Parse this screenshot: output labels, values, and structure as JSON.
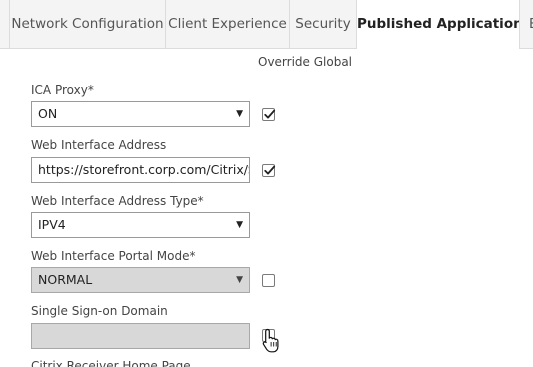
{
  "tabs": [
    {
      "label": "Network Configuration",
      "active": false
    },
    {
      "label": "Client Experience",
      "active": false
    },
    {
      "label": "Security",
      "active": false
    },
    {
      "label": "Published Applications",
      "active": true
    },
    {
      "label": "E",
      "active": false
    }
  ],
  "override_header": "Override Global",
  "fields": {
    "ica_proxy": {
      "label": "ICA Proxy*",
      "value": "ON",
      "override_checked": true
    },
    "web_interface_address": {
      "label": "Web Interface Address",
      "value": "https://storefront.corp.com/Citrix/St",
      "override_checked": true
    },
    "web_interface_address_type": {
      "label": "Web Interface Address Type*",
      "value": "IPV4"
    },
    "web_interface_portal_mode": {
      "label": "Web Interface Portal Mode*",
      "value": "NORMAL",
      "override_checked": false,
      "disabled": true
    },
    "single_sign_on_domain": {
      "label": "Single Sign-on Domain",
      "value": "",
      "override_checked": false,
      "disabled": true
    },
    "citrix_receiver_home_page": {
      "label": "Citrix Receiver Home Page"
    }
  },
  "colors": {
    "tab_bar_bg": "#f4f4f4",
    "disabled_bg": "#d8d8d8",
    "border": "#9a9a9a",
    "label_text": "#444444"
  },
  "icons": {
    "select_arrow": "triangle-down",
    "checkmark": "check",
    "cursor": "hand-pointer"
  }
}
